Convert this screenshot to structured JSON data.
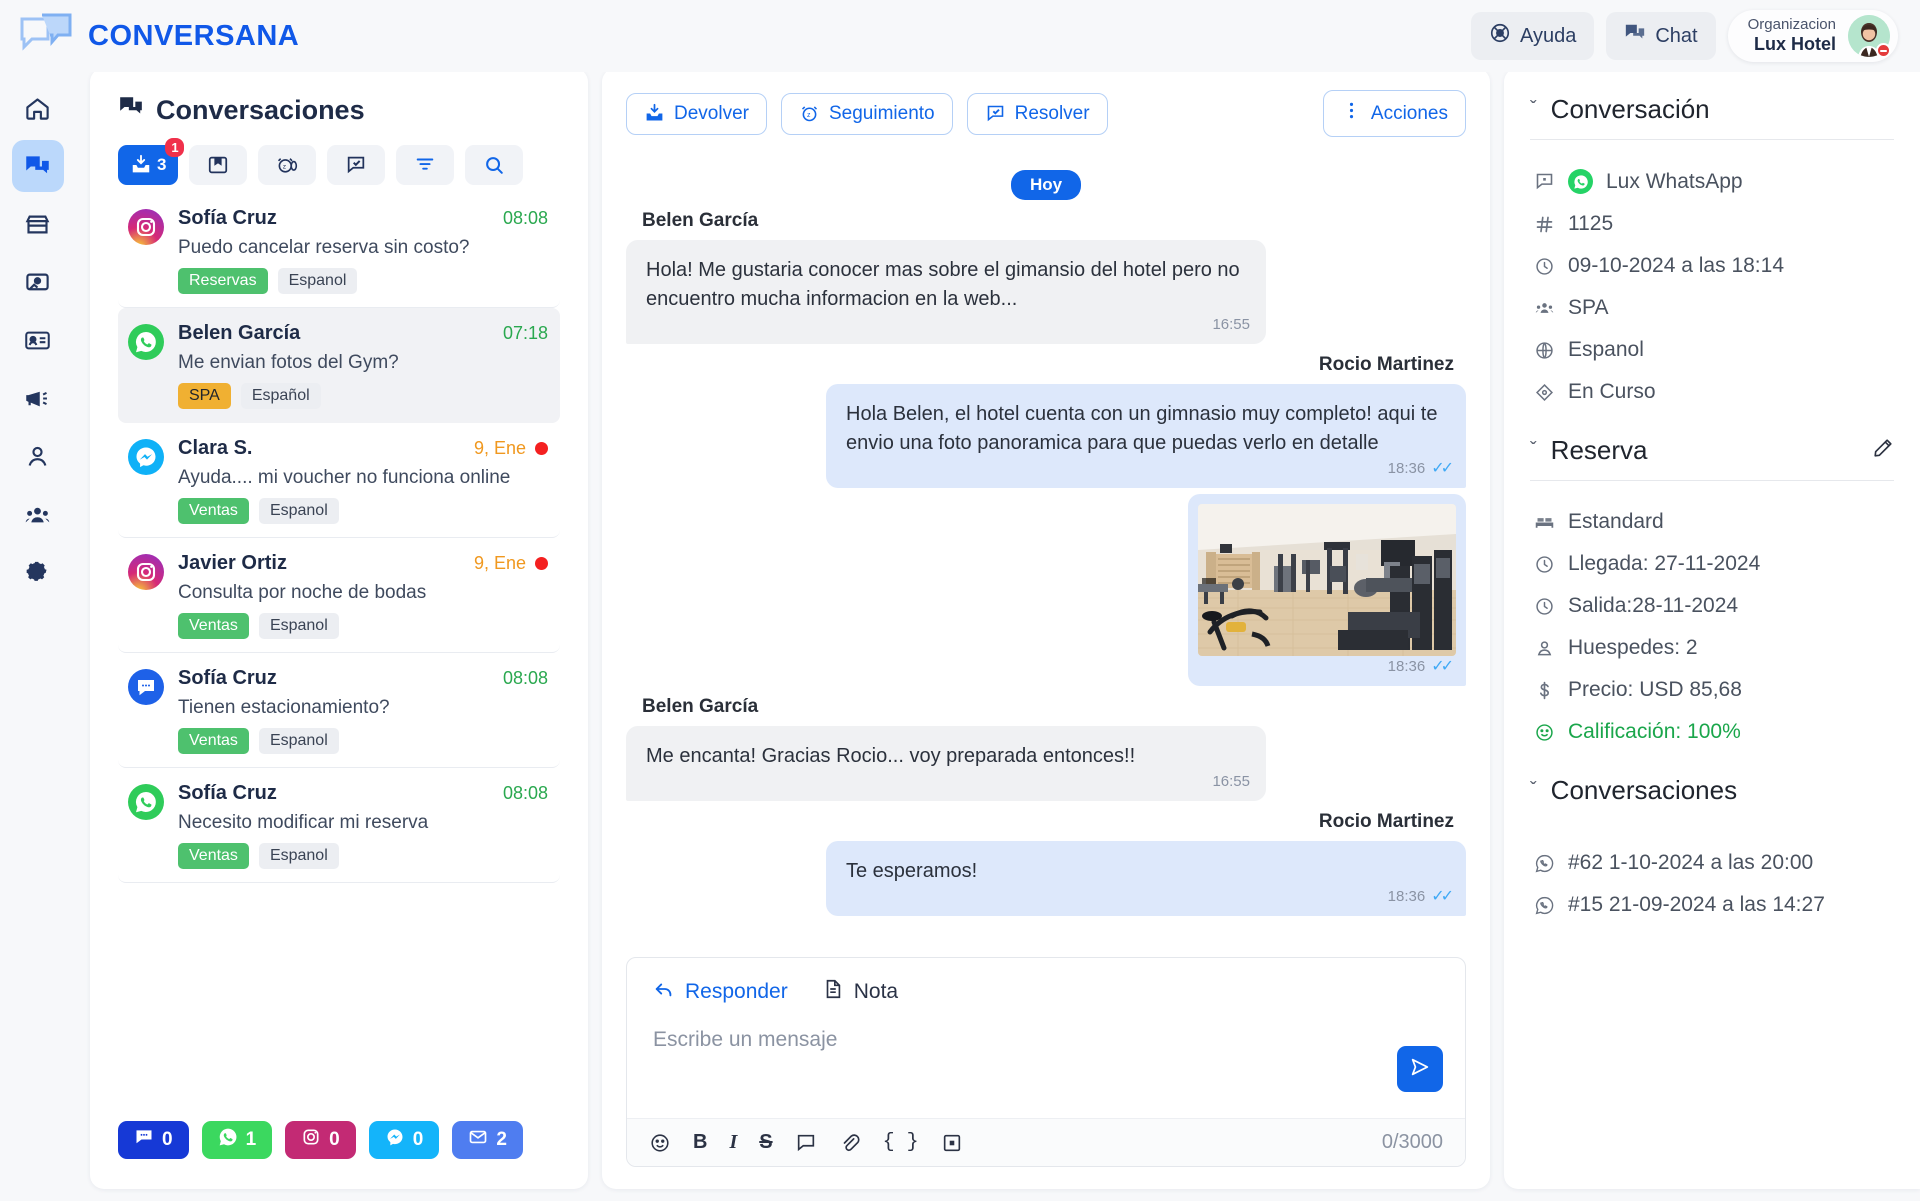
{
  "app": {
    "brand": "CONVERSANA",
    "logo_icon": "chat-bubbles-logo"
  },
  "topbar": {
    "help_label": "Ayuda",
    "help_icon": "lifebuoy-icon",
    "chat_label": "Chat",
    "chat_icon": "chat-icon",
    "org_label": "Organizacion",
    "org_name": "Lux Hotel",
    "avatar_icon": "user-avatar",
    "status_icon": "busy-status-dot"
  },
  "rail": {
    "items": [
      {
        "name": "home",
        "icon": "home-icon",
        "active": false
      },
      {
        "name": "conversations",
        "icon": "chat-bubbles-icon",
        "active": true
      },
      {
        "name": "store",
        "icon": "storefront-icon",
        "active": false
      },
      {
        "name": "media",
        "icon": "image-window-icon",
        "active": false
      },
      {
        "name": "contacts",
        "icon": "id-card-icon",
        "active": false
      },
      {
        "name": "campaigns",
        "icon": "megaphone-icon",
        "active": false
      },
      {
        "name": "profile",
        "icon": "person-icon",
        "active": false
      },
      {
        "name": "teams",
        "icon": "group-icon",
        "active": false
      },
      {
        "name": "settings",
        "icon": "gear-icon",
        "active": false
      }
    ]
  },
  "conversations_panel": {
    "title": "Conversaciones",
    "title_icon": "chat-bubbles-icon",
    "filters": [
      {
        "name": "inbox",
        "icon": "inbox-down-icon",
        "count": "3",
        "badge": "1",
        "primary": true
      },
      {
        "name": "saved",
        "icon": "bookmark-box-icon",
        "primary": false
      },
      {
        "name": "snoozed",
        "icon": "alarm-clock-icon",
        "primary": false
      },
      {
        "name": "resolved",
        "icon": "chat-check-icon",
        "primary": false
      },
      {
        "name": "filter",
        "icon": "filter-icon",
        "primary": false
      },
      {
        "name": "search",
        "icon": "search-icon",
        "primary": false
      }
    ],
    "items": [
      {
        "name": "Sofía Cruz",
        "preview": "Puedo cancelar reserva sin costo?",
        "time": "08:08",
        "time_color": "green",
        "unread": false,
        "selected": false,
        "channel": "instagram",
        "tags": [
          {
            "label": "Reservas",
            "style": "green"
          },
          {
            "label": "Espanol",
            "style": "grey"
          }
        ]
      },
      {
        "name": "Belen García",
        "preview": "Me envian fotos del Gym?",
        "time": "07:18",
        "time_color": "green",
        "unread": false,
        "selected": true,
        "channel": "whatsapp",
        "tags": [
          {
            "label": "SPA",
            "style": "amber"
          },
          {
            "label": "Español",
            "style": "grey"
          }
        ]
      },
      {
        "name": "Clara S.",
        "preview": "Ayuda.... mi voucher no funciona online",
        "time": "9, Ene",
        "time_color": "orange",
        "unread": true,
        "selected": false,
        "channel": "messenger",
        "tags": [
          {
            "label": "Ventas",
            "style": "green"
          },
          {
            "label": "Espanol",
            "style": "grey"
          }
        ]
      },
      {
        "name": "Javier Ortiz",
        "preview": "Consulta por noche de bodas",
        "time": "9, Ene",
        "time_color": "orange",
        "unread": true,
        "selected": false,
        "channel": "instagram",
        "tags": [
          {
            "label": "Ventas",
            "style": "green"
          },
          {
            "label": "Espanol",
            "style": "grey"
          }
        ]
      },
      {
        "name": "Sofía Cruz",
        "preview": "Tienen estacionamiento?",
        "time": "08:08",
        "time_color": "green",
        "unread": false,
        "selected": false,
        "channel": "webchat",
        "tags": [
          {
            "label": "Ventas",
            "style": "green"
          },
          {
            "label": "Espanol",
            "style": "grey"
          }
        ]
      },
      {
        "name": "Sofía Cruz",
        "preview": "Necesito modificar mi reserva",
        "time": "08:08",
        "time_color": "green",
        "unread": false,
        "selected": false,
        "channel": "whatsapp",
        "tags": [
          {
            "label": "Ventas",
            "style": "green"
          },
          {
            "label": "Espanol",
            "style": "grey"
          }
        ]
      }
    ],
    "channel_counters": [
      {
        "name": "webchat",
        "icon": "webchat-icon",
        "count": "0",
        "color": "#1639d6"
      },
      {
        "name": "whatsapp",
        "icon": "whatsapp-icon",
        "count": "1",
        "color": "#3bd85f"
      },
      {
        "name": "instagram",
        "icon": "instagram-icon",
        "count": "0",
        "color": "#c32a74"
      },
      {
        "name": "messenger",
        "icon": "messenger-icon",
        "count": "0",
        "color": "#14b4fa"
      },
      {
        "name": "email",
        "icon": "envelope-icon",
        "count": "2",
        "color": "#4f7df0"
      }
    ]
  },
  "chat": {
    "actions": [
      {
        "label": "Devolver",
        "icon": "inbox-down-icon"
      },
      {
        "label": "Seguimiento",
        "icon": "alarm-clock-icon"
      },
      {
        "label": "Resolver",
        "icon": "chat-check-icon"
      }
    ],
    "more_label": "Acciones",
    "more_icon": "vertical-dots-icon",
    "day_divider": "Hoy",
    "messages": [
      {
        "author": "Belen García",
        "direction": "in",
        "type": "text",
        "text": "Hola! Me gustaria conocer mas sobre el gimansio del hotel pero no encuentro mucha informacion en la web...",
        "time": "16:55",
        "read": false
      },
      {
        "author": "Rocio  Martinez",
        "direction": "out",
        "type": "text",
        "text": "Hola Belen, el hotel cuenta con un gimnasio muy completo! aqui te envio una foto panoramica para que puedas verlo en detalle",
        "time": "18:36",
        "read": true
      },
      {
        "author": "",
        "direction": "out",
        "type": "image",
        "image_alt": "hotel-gym-photo",
        "time": "18:36",
        "read": true
      },
      {
        "author": "Belen García",
        "direction": "in",
        "type": "text",
        "text": "Me encanta! Gracias Rocio... voy preparada entonces!!",
        "time": "16:55",
        "read": false
      },
      {
        "author": "Rocio  Martinez",
        "direction": "out",
        "type": "text",
        "text": "Te esperamos!",
        "time": "18:36",
        "read": true
      }
    ]
  },
  "composer": {
    "tab_reply": "Responder",
    "tab_reply_icon": "reply-arrow-icon",
    "tab_note": "Nota",
    "tab_note_icon": "document-icon",
    "placeholder": "Escribe un mensaje",
    "send_icon": "send-icon",
    "char_count": "0/3000",
    "tools": [
      {
        "name": "emoji",
        "icon": "emoji-icon",
        "glyph": "☺"
      },
      {
        "name": "bold",
        "icon": "bold-icon",
        "glyph": "B"
      },
      {
        "name": "italic",
        "icon": "italic-icon",
        "glyph": "I"
      },
      {
        "name": "strike",
        "icon": "strikethrough-icon",
        "glyph": "S"
      },
      {
        "name": "quick-reply",
        "icon": "chat-icon",
        "glyph": ""
      },
      {
        "name": "attach",
        "icon": "paperclip-icon",
        "glyph": ""
      },
      {
        "name": "variables",
        "icon": "braces-icon",
        "glyph": "{}"
      },
      {
        "name": "template",
        "icon": "template-icon",
        "glyph": ""
      }
    ]
  },
  "detail": {
    "conversation": {
      "heading": "Conversación",
      "chevron": "ˇ",
      "channel_name": "Lux WhatsApp",
      "channel_icon": "whatsapp-icon",
      "channel_prefix_icon": "channel-icon",
      "id": "1125",
      "id_icon": "hash-icon",
      "datetime": "09-10-2024 a las 18:14",
      "datetime_icon": "clock-icon",
      "team": "SPA",
      "team_icon": "group-icon",
      "language": "Espanol",
      "language_icon": "globe-icon",
      "status": "En Curso",
      "status_icon": "diamond-icon"
    },
    "reserva": {
      "heading": "Reserva",
      "chevron": "ˇ",
      "edit_icon": "pencil-icon",
      "room_type": "Estandard",
      "room_icon": "bed-icon",
      "arrival": "Llegada: 27-11-2024",
      "arrival_icon": "clock-icon",
      "departure": "Salida:28-11-2024",
      "departure_icon": "clock-icon",
      "guests": "Huespedes: 2",
      "guests_icon": "person-icon",
      "price": "Precio: USD 85,68",
      "price_icon": "dollar-icon",
      "rating": "Calificación: 100%",
      "rating_icon": "smiley-icon"
    },
    "conversaciones": {
      "heading": "Conversaciones",
      "chevron": "ˇ",
      "items": [
        {
          "icon": "whatsapp-outline-icon",
          "label": "#62 1-10-2024 a las 20:00"
        },
        {
          "icon": "whatsapp-outline-icon",
          "label": "#15 21-09-2024 a las 14:27"
        }
      ]
    }
  },
  "colors": {
    "brand_blue": "#1058e8",
    "accent_blue": "#1166e8",
    "green": "#2aa84f",
    "orange": "#f0981f",
    "red": "#f42020",
    "whatsapp": "#25d366"
  }
}
